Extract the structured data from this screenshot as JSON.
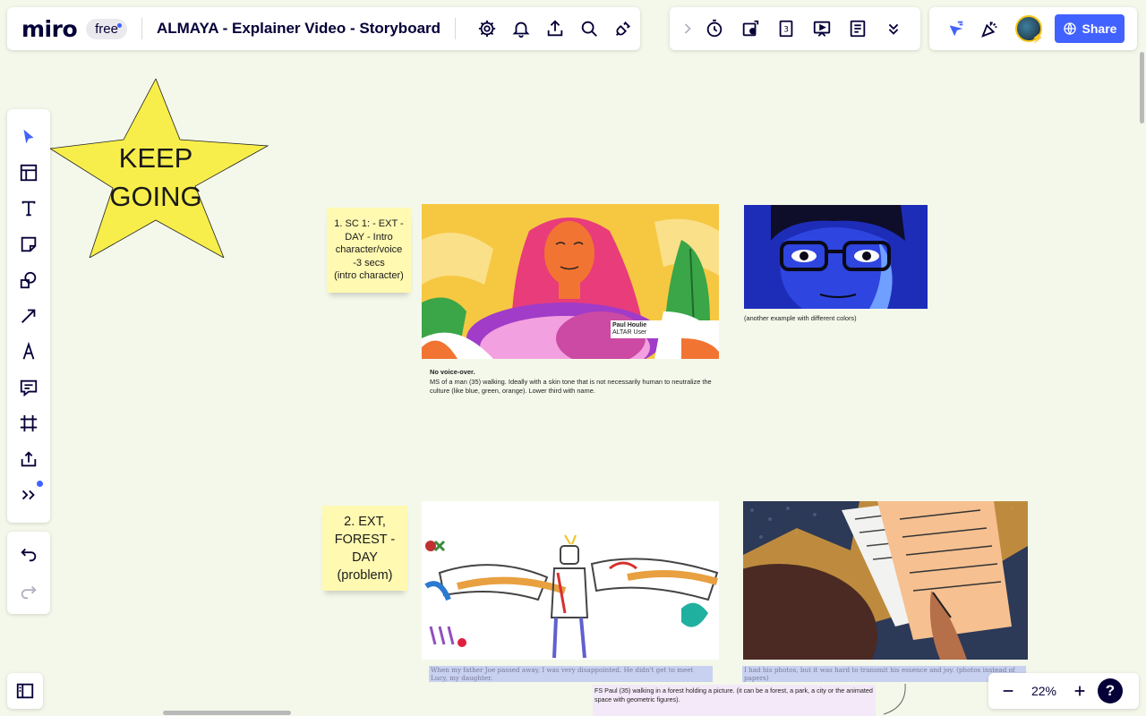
{
  "header": {
    "logo": "miro",
    "plan": "free",
    "board_title": "ALMAYA - Explainer Video - Storyboard",
    "share_label": "Share"
  },
  "board": {
    "star_text": "KEEP\nGOING",
    "scene1": {
      "sticky": "1. SC 1: - EXT - DAY - Intro character/voice -3 secs\n(intro character)",
      "lower_third_name": "Paul Houlie",
      "lower_third_role": "ALTAR User",
      "caption_title": "No voice-over.",
      "caption_body": "MS of a man (35) walking. Ideally with a skin tone that is not necessarily human to neutralize the culture (like blue, green, orange). Lower third with name.",
      "alt_caption": "(another example with different colors)"
    },
    "scene2": {
      "sticky": "2. EXT, FOREST - DAY (problem)",
      "caption_left": "When my father Joe passed away, I was very disappointed. He didn't get to meet Lucy, my daughter.",
      "caption_right": "I had his photos, but it was hard to transmit his essence and joy. (photos instead of papers)",
      "caption_bottom": "FS Paul (35) walking in a forest holding a picture. (it can be a forest, a park, a city or the animated space with geometric figures)."
    }
  },
  "zoom": {
    "value": "22%",
    "help": "?"
  },
  "icons": {
    "top_left": [
      "settings-icon",
      "bell-icon",
      "upload-icon",
      "search-icon",
      "plugin-icon"
    ],
    "top_mid": [
      "chevron-right-icon",
      "timer-icon",
      "sticky-reaction-icon",
      "card-3-icon",
      "presentation-icon",
      "notes-icon",
      "chevron-down-icon"
    ],
    "top_right": [
      "cursor-filter-icon",
      "celebrate-icon",
      "avatar",
      "globe-icon"
    ],
    "left": [
      "select-icon",
      "templates-icon",
      "text-icon",
      "sticky-note-icon",
      "shapes-icon",
      "arrow-icon",
      "pen-icon",
      "comment-icon",
      "frame-icon",
      "upload-icon",
      "more-icon"
    ],
    "undo": [
      "undo-icon",
      "redo-icon"
    ]
  },
  "colors": {
    "accent": "#4262ff",
    "canvas": "#f4f8ea",
    "sticky": "#fff9b1",
    "star": "#f8ee4b"
  }
}
